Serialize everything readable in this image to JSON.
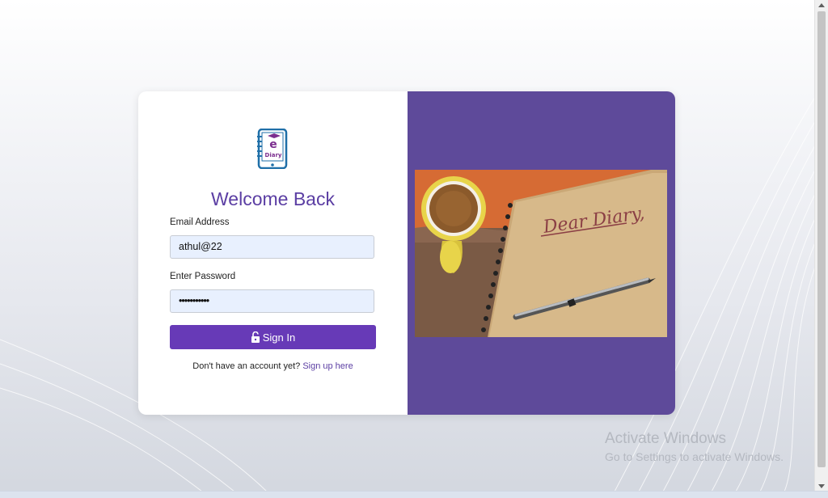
{
  "app": {
    "logo_text": "Diary",
    "logo_letter": "e"
  },
  "login": {
    "title": "Welcome Back",
    "email_label": "Email Address",
    "email_value": "athul@22",
    "password_label": "Enter Password",
    "password_mask": "•••••••••••",
    "signin_label": "Sign In",
    "signup_prompt": "Don't have an account yet?",
    "signup_link": "Sign up here"
  },
  "photo": {
    "notebook_text": "Dear Diary,"
  },
  "watermark": {
    "line1": "Activate Windows",
    "line2": "Go to Settings to activate Windows."
  },
  "colors": {
    "accent": "#673ab7",
    "title": "#5b3ea3",
    "panel": "#5e4a9a",
    "input_bg": "#e8f0fe"
  },
  "icons": [
    "logo-icon",
    "unlock-icon",
    "scroll-up-icon",
    "scroll-down-icon"
  ]
}
